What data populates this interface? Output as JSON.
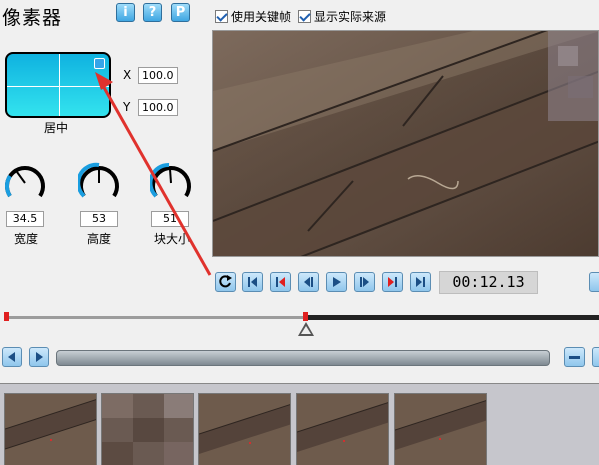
{
  "header": {
    "title": "像素器",
    "info_label": "i",
    "help_label": "?",
    "p_label": "P"
  },
  "options": {
    "use_keyframes": "使用关键帧",
    "show_actual_source": "显示实际来源"
  },
  "position": {
    "label": "居中",
    "x_label": "X",
    "x_value": "100.0",
    "y_label": "Y",
    "y_value": "100.0"
  },
  "knobs": [
    {
      "label": "宽度",
      "value": "34.5"
    },
    {
      "label": "高度",
      "value": "53"
    },
    {
      "label": "块大小",
      "value": "51"
    }
  ],
  "transport": {
    "timecode": "00:12.13"
  },
  "colors": {
    "accent": "#3fa6e2",
    "knob": "#1a9ee0",
    "marker": "#e02020",
    "arrow": "#e0322d"
  }
}
